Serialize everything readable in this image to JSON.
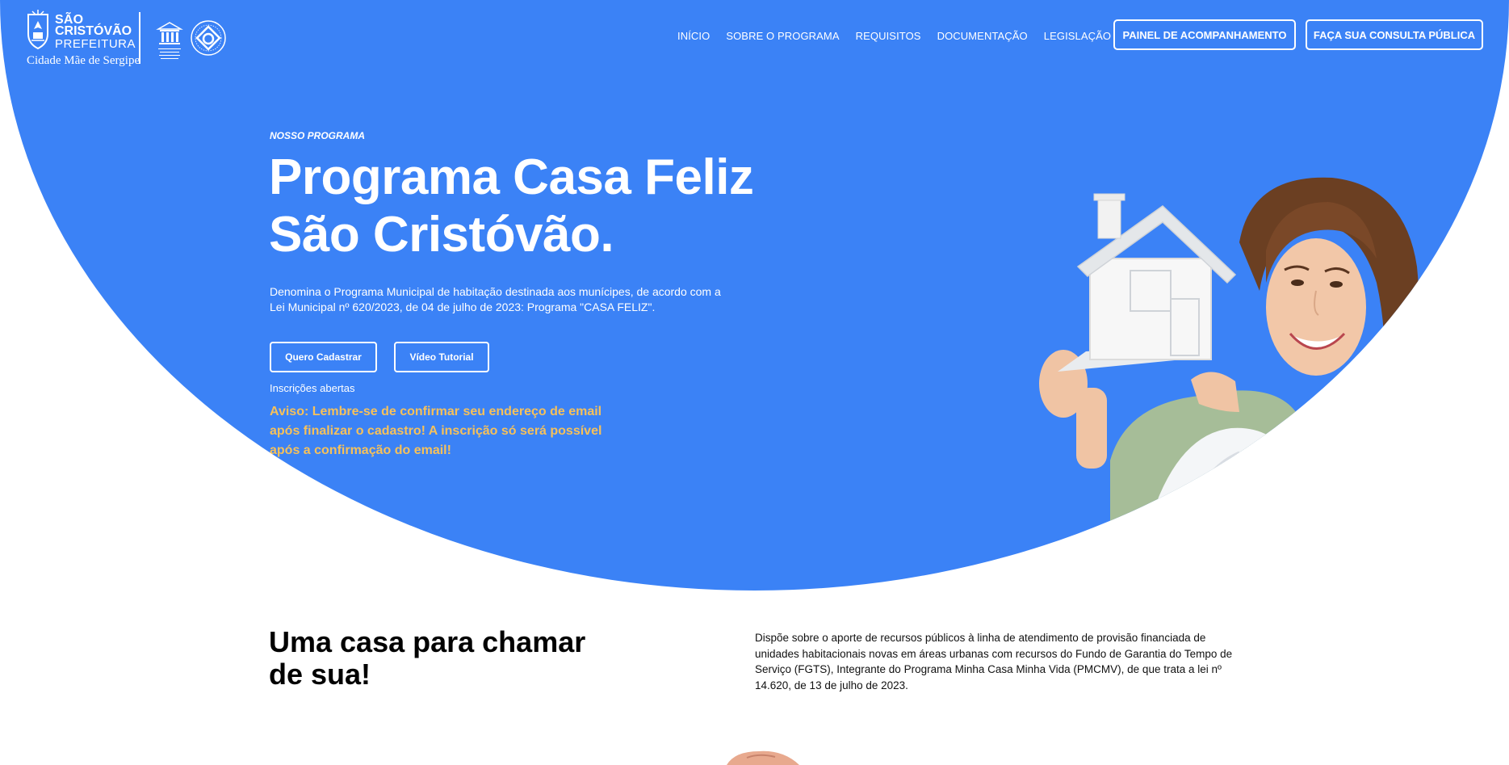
{
  "header": {
    "brand": {
      "line1": "SÃO",
      "line2": "CRISTÓVÃO",
      "line3": "PREFEITURA",
      "tagline": "Cidade Mãe de Sergipe"
    },
    "nav": [
      {
        "label": "INÍCIO"
      },
      {
        "label": "SOBRE O PROGRAMA"
      },
      {
        "label": "REQUISITOS"
      },
      {
        "label": "DOCUMENTAÇÃO"
      },
      {
        "label": "LEGISLAÇÃO"
      }
    ],
    "buttons": {
      "painel": "PAINEL DE ACOMPANHAMENTO",
      "consulta": "FAÇA SUA CONSULTA PÚBLICA"
    }
  },
  "hero": {
    "eyebrow": "NOSSO PROGRAMA",
    "title": "Programa Casa Feliz São Cristóvão.",
    "description": "Denomina o Programa Municipal de habitação destinada aos munícipes, de acordo com a Lei Municipal nº 620/2023, de 04 de julho de 2023: Programa \"CASA FELIZ\".",
    "buttons": {
      "cadastrar": "Quero Cadastrar",
      "tutorial": "Vídeo Tutorial"
    },
    "status": "Inscrições abertas",
    "notice": "Aviso: Lembre-se de confirmar seu endereço de email após finalizar o cadastro! A inscrição só será possível após a confirmação do email!"
  },
  "section": {
    "title": "Uma casa para chamar de sua!",
    "text": "Dispõe sobre o aporte de recursos públicos à linha de atendimento de provisão financiada de unidades habitacionais novas em áreas urbanas com recursos do Fundo de Garantia do Tempo de Serviço (FGTS), Integrante do Programa Minha Casa Minha Vida (PMCMV), de que trata a lei nº 14.620, de 13 de julho de 2023."
  },
  "colors": {
    "hero_bg": "#3b82f6",
    "notice": "#f6c15a",
    "white": "#ffffff"
  },
  "icons": [
    "crest-icon",
    "unesco-icon",
    "world-heritage-icon"
  ]
}
